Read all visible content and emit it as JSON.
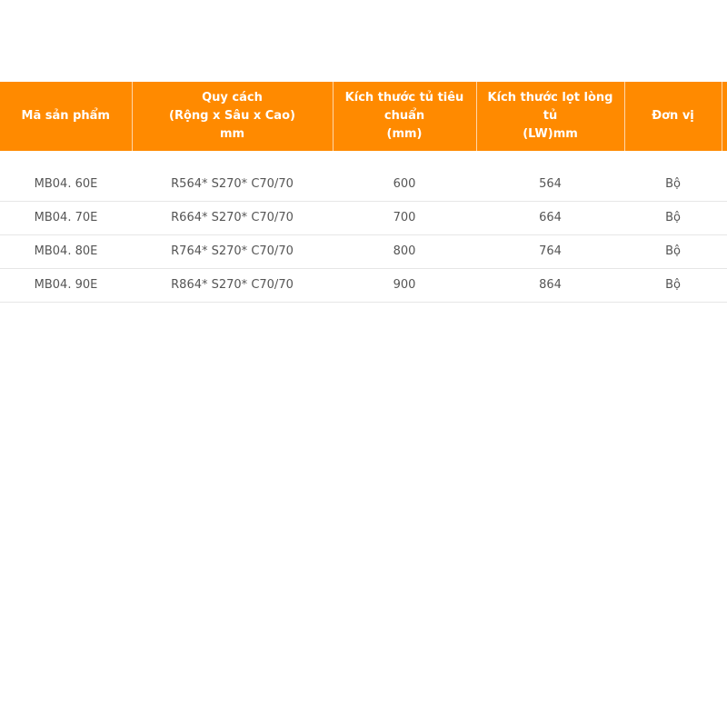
{
  "table": {
    "headers": [
      {
        "lines": [
          "Mã sản phẩm"
        ]
      },
      {
        "lines": [
          "Quy cách",
          "(Rộng x Sâu x Cao)",
          "mm"
        ]
      },
      {
        "lines": [
          "Kích thước tủ tiêu",
          "chuẩn",
          "(mm)"
        ]
      },
      {
        "lines": [
          "Kích thước lọt lòng tủ",
          "(LW)mm"
        ]
      },
      {
        "lines": [
          "Đơn vị"
        ]
      },
      {
        "lines": [
          ""
        ]
      }
    ],
    "rows": [
      [
        "MB04. 60E",
        "R564* S270* C70/70",
        "600",
        "564",
        "Bộ"
      ],
      [
        "MB04. 70E",
        "R664* S270* C70/70",
        "700",
        "664",
        "Bộ"
      ],
      [
        "MB04. 80E",
        "R764* S270* C70/70",
        "800",
        "764",
        "Bộ"
      ],
      [
        "MB04. 90E",
        "R864* S270* C70/70",
        "900",
        "864",
        "Bộ"
      ]
    ]
  },
  "colors": {
    "header_background": "#ff8a00",
    "header_text": "#ffffff",
    "cell_text": "#555555",
    "row_border": "#e6e6e6"
  }
}
